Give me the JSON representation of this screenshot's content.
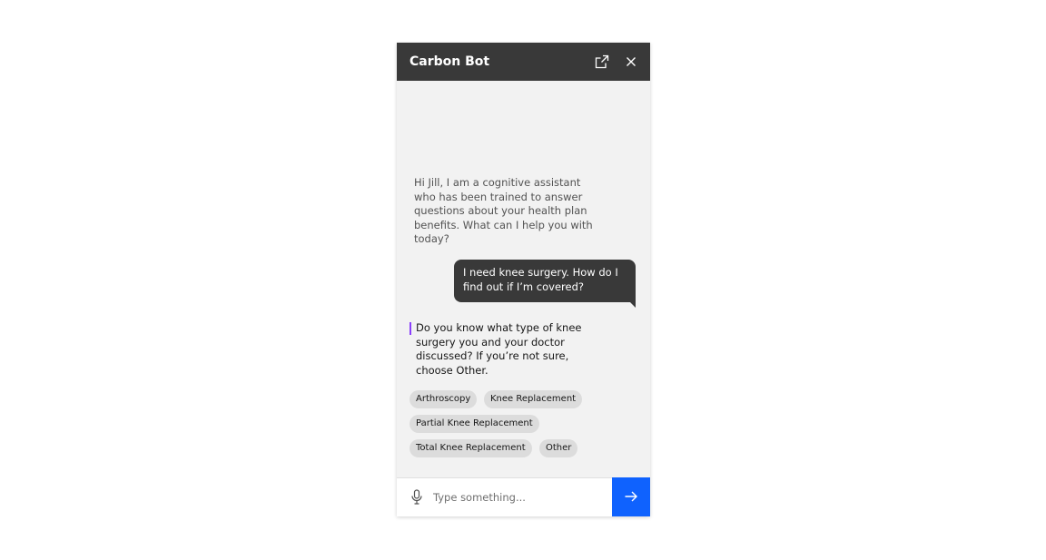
{
  "window": {
    "title": "Carbon Bot"
  },
  "icons": {
    "popout": "launch-icon",
    "close": "close-icon",
    "mic": "microphone-icon",
    "send": "arrow-right-icon"
  },
  "colors": {
    "header_bg": "#393939",
    "chat_bg": "#f2f2f2",
    "user_bubble": "#393939",
    "accent": "#8a3ffc",
    "send_button": "#0f62fe",
    "chip_bg": "#dcdcdc"
  },
  "messages": {
    "bot_greeting": "Hi Jill, I am a cognitive assistant who has been trained to answer questions about your health plan benefits. What can I help you with today?",
    "user_message": "I need knee surgery. How do I find out if I’m covered?",
    "bot_question": "Do you know what type of knee surgery you and your doctor discussed? If you’re not sure, choose Other."
  },
  "options": [
    "Arthroscopy",
    "Knee Replacement",
    "Partial Knee Replacement",
    "Total Knee Replacement",
    "Other"
  ],
  "input": {
    "placeholder": "Type something...",
    "value": ""
  }
}
